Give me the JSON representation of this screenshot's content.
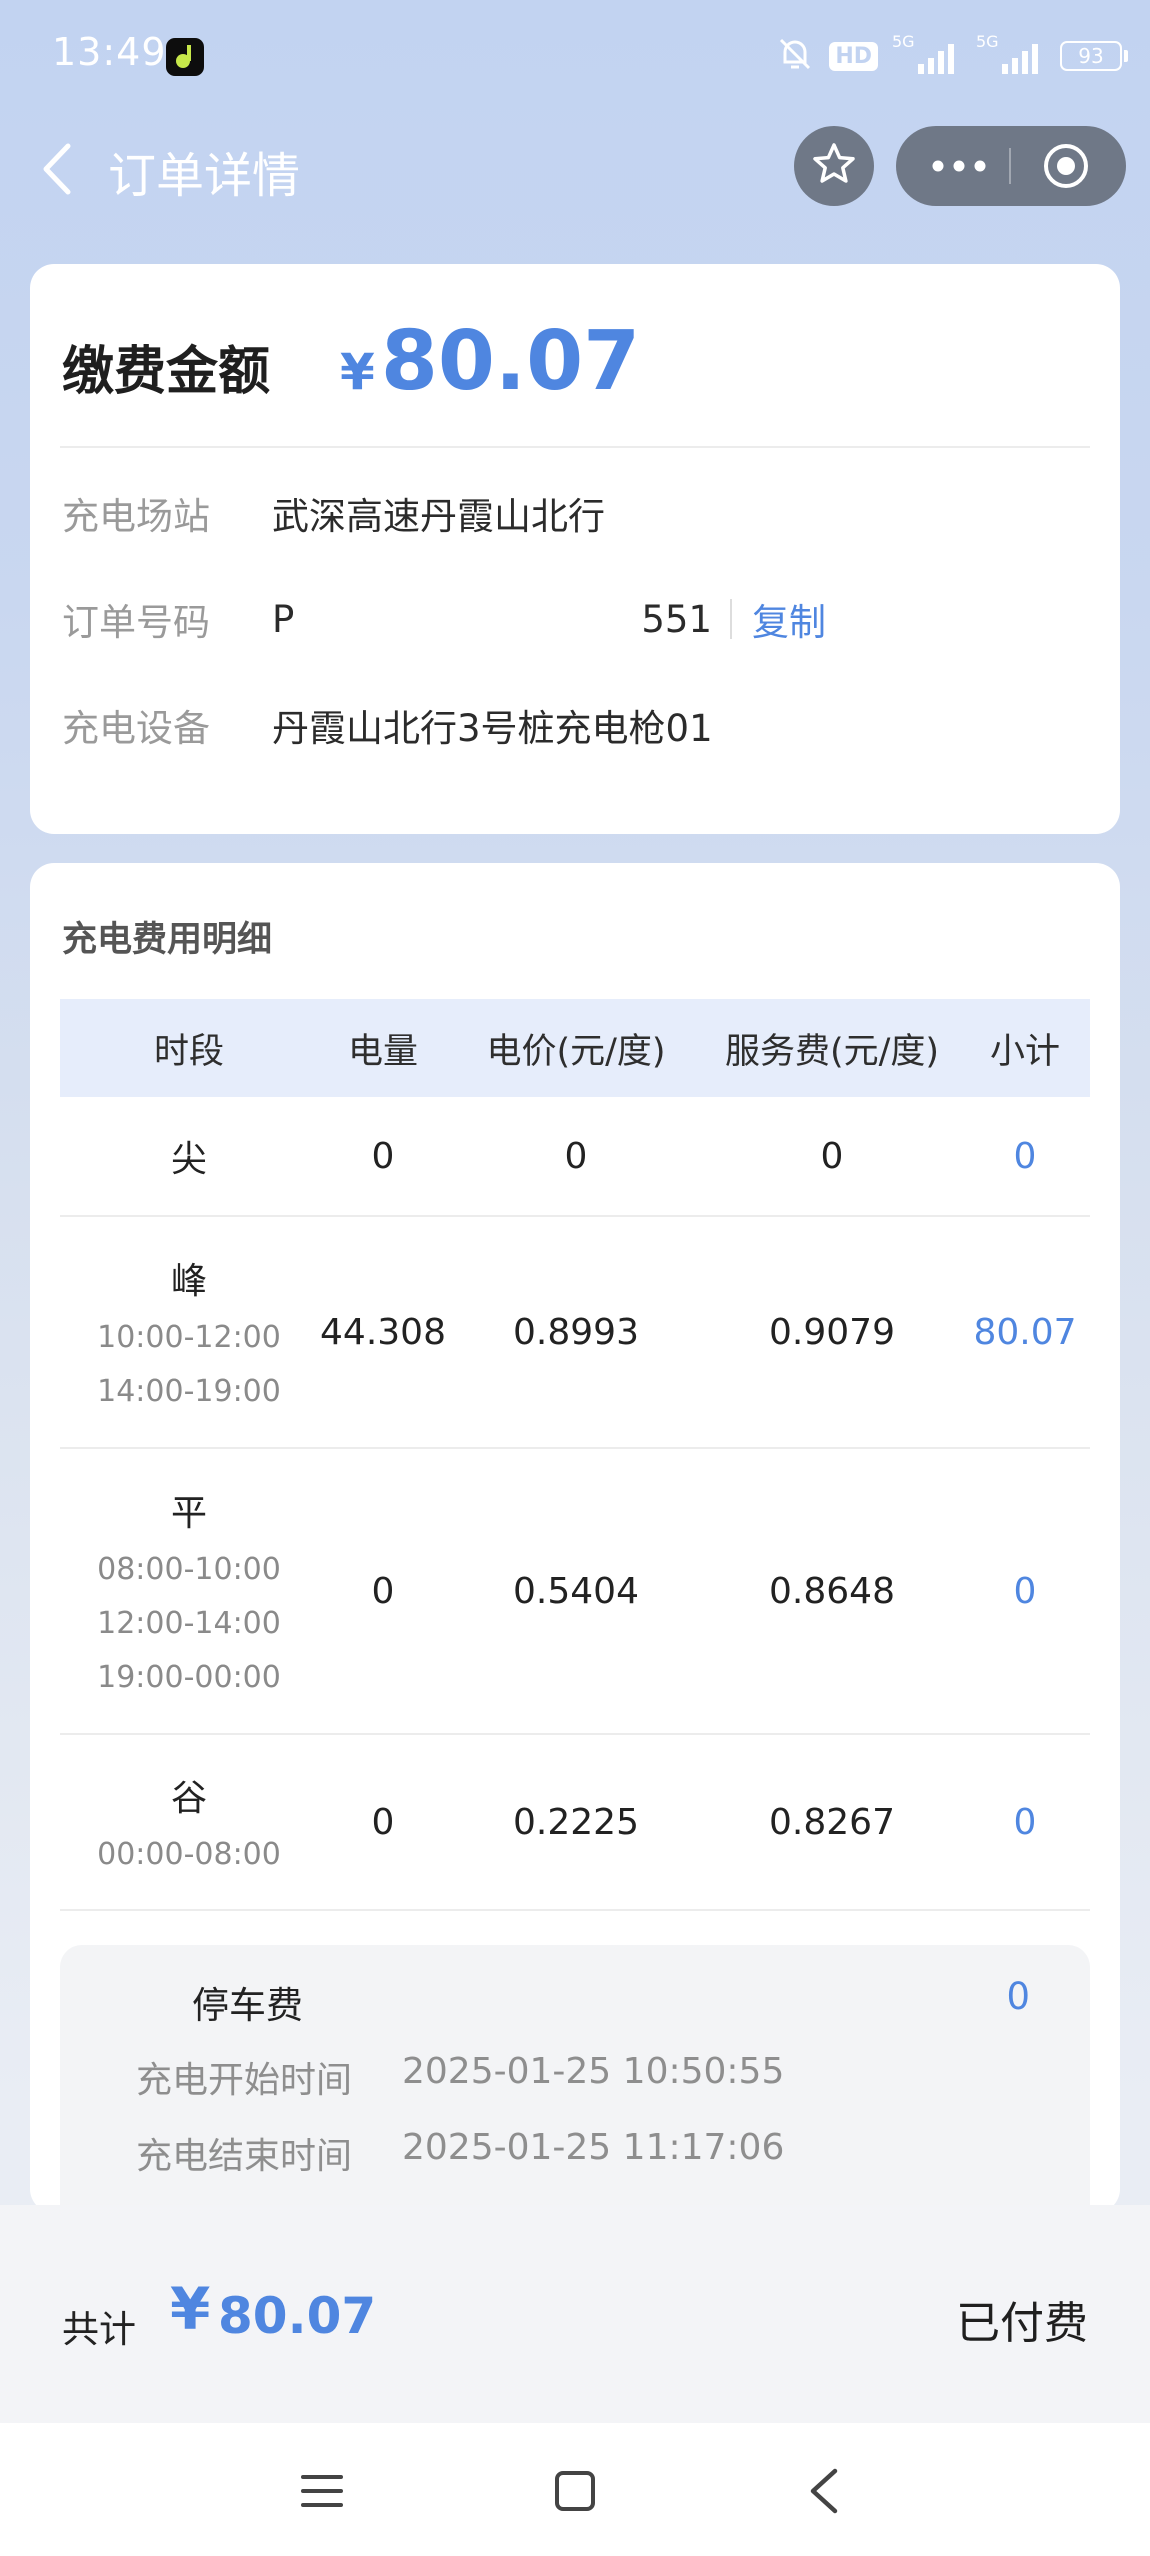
{
  "status_bar": {
    "time": "13:49",
    "network_label": "HD",
    "signal_1_label": "5G",
    "signal_2_label": "5G",
    "battery": "93"
  },
  "nav": {
    "title": "订单详情"
  },
  "order": {
    "amount_label": "缴费金额",
    "currency": "¥",
    "amount": "80.07",
    "station_label": "充电场站",
    "station_value": "武深高速丹霞山北行",
    "order_no_label": "订单号码",
    "order_no_start": "P",
    "order_no_end": "551",
    "copy_label": "复制",
    "device_label": "充电设备",
    "device_value": "丹霞山北行3号桩充电枪01"
  },
  "detail": {
    "title": "充电费用明细",
    "headers": [
      "时段",
      "电量",
      "电价(元/度)",
      "服务费(元/度)",
      "小计"
    ],
    "rows": [
      {
        "period": "尖",
        "ranges": [],
        "energy": "0",
        "price": "0",
        "service": "0",
        "subtotal": "0"
      },
      {
        "period": "峰",
        "ranges": [
          "10:00-12:00",
          "14:00-19:00"
        ],
        "energy": "44.308",
        "price": "0.8993",
        "service": "0.9079",
        "subtotal": "80.07"
      },
      {
        "period": "平",
        "ranges": [
          "08:00-10:00",
          "12:00-14:00",
          "19:00-00:00"
        ],
        "energy": "0",
        "price": "0.5404",
        "service": "0.8648",
        "subtotal": "0"
      },
      {
        "period": "谷",
        "ranges": [
          "00:00-08:00"
        ],
        "energy": "0",
        "price": "0.2225",
        "service": "0.8267",
        "subtotal": "0"
      }
    ],
    "parking_label": "停车费",
    "parking_value": "0",
    "start_time_label": "充电开始时间",
    "start_time_value": "2025-01-25 10:50:55",
    "end_time_label": "充电结束时间",
    "end_time_value": "2025-01-25 11:17:06"
  },
  "bottom": {
    "total_label": "共计",
    "currency": "¥",
    "total_value": "80.07",
    "status": "已付费"
  },
  "colors": {
    "accent": "#4f86e0",
    "background_top": "#c2d3f1",
    "header_row": "#e6edfb",
    "capsule": "#6f7887"
  },
  "icons": [
    "bell-muted-icon",
    "signal-icon",
    "battery-icon",
    "back-chevron-icon",
    "star-icon",
    "more-dots-icon",
    "target-icon",
    "menu-icon",
    "home-square-icon",
    "back-triangle-icon"
  ]
}
